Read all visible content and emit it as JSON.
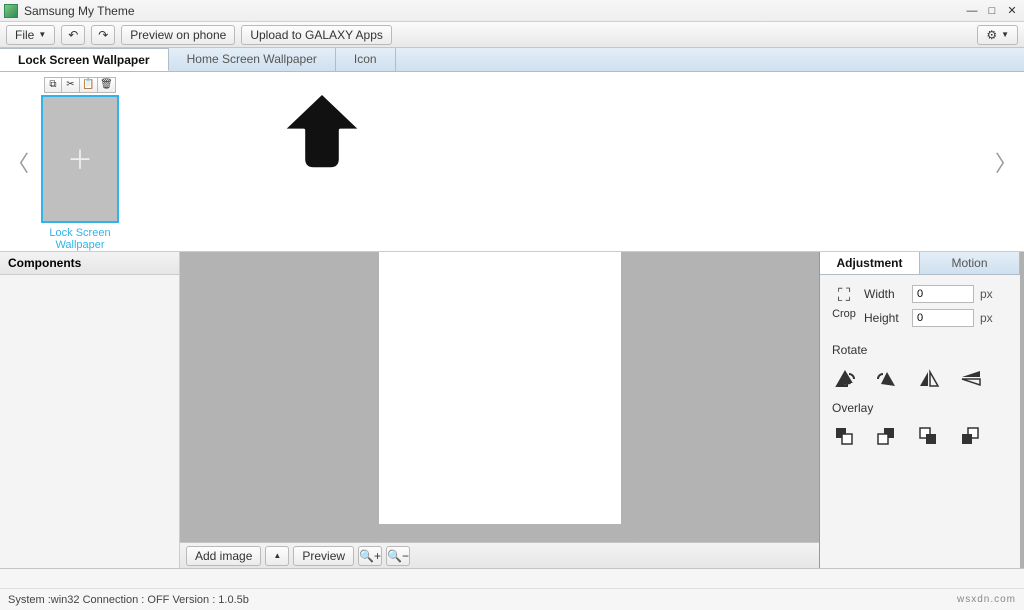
{
  "window": {
    "title": "Samsung My Theme"
  },
  "toolbar": {
    "file_label": "File",
    "preview_label": "Preview on phone",
    "upload_label": "Upload to GALAXY Apps"
  },
  "tabs": {
    "items": [
      {
        "label": "Lock Screen Wallpaper",
        "active": true
      },
      {
        "label": "Home Screen Wallpaper",
        "active": false
      },
      {
        "label": "Icon",
        "active": false
      }
    ]
  },
  "gallery": {
    "thumb_label": "Lock Screen Wallpaper"
  },
  "panels": {
    "components_label": "Components",
    "canvas_tools": {
      "add_image_label": "Add image",
      "preview_label": "Preview"
    }
  },
  "adjustment": {
    "tabs": {
      "adjustment_label": "Adjustment",
      "motion_label": "Motion"
    },
    "crop_label": "Crop",
    "width_label": "Width",
    "height_label": "Height",
    "width_value": "0",
    "height_value": "0",
    "unit": "px",
    "rotate_label": "Rotate",
    "overlay_label": "Overlay"
  },
  "status": {
    "text": "System :win32 Connection : OFF Version : 1.0.5b",
    "watermark": "wsxdn.com"
  }
}
